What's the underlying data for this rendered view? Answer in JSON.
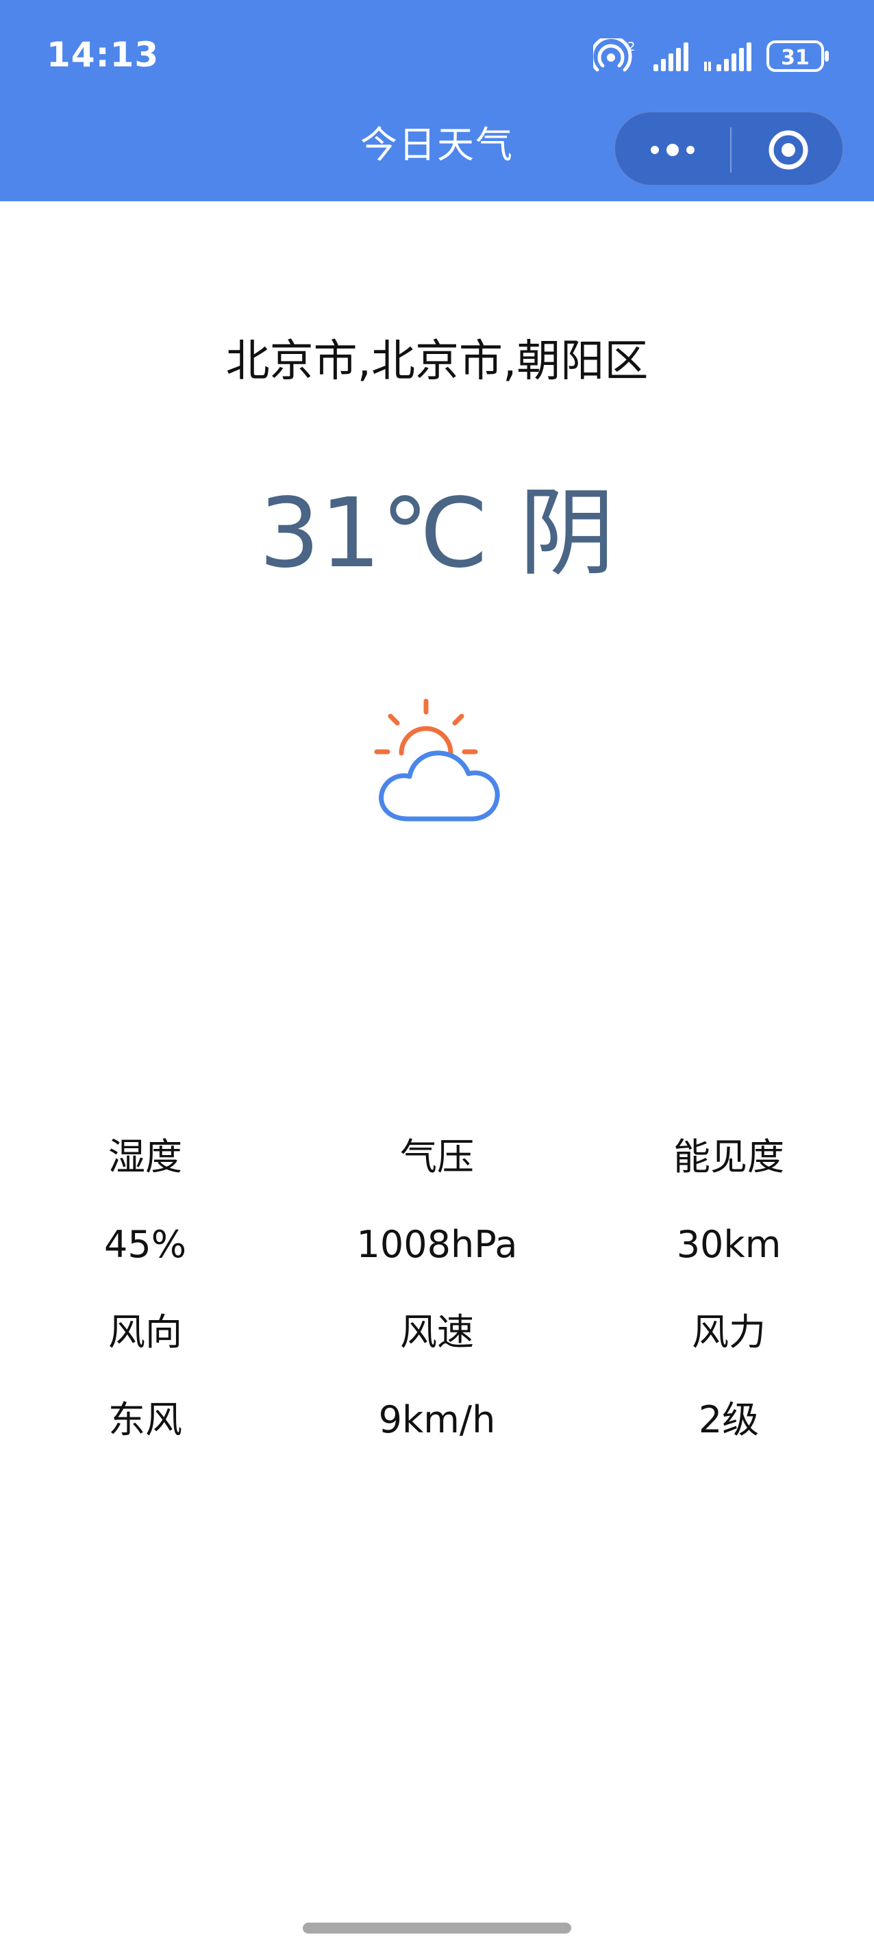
{
  "status_bar": {
    "time": "14:13",
    "battery": "31",
    "hotspot_superscript": "2"
  },
  "nav": {
    "title": "今日天气"
  },
  "location": "北京市,北京市,朝阳区",
  "current": {
    "temperature": "31℃",
    "condition": "阴"
  },
  "colors": {
    "header": "#4f86ec",
    "temperature_text": "#4a6585",
    "sun": "#f0713d",
    "cloud": "#4a86ea"
  },
  "details": [
    [
      "湿度",
      "气压",
      "能见度"
    ],
    [
      "45%",
      "1008hPa",
      "30km"
    ],
    [
      "风向",
      "风速",
      "风力"
    ],
    [
      "东风",
      "9km/h",
      "2级"
    ]
  ]
}
